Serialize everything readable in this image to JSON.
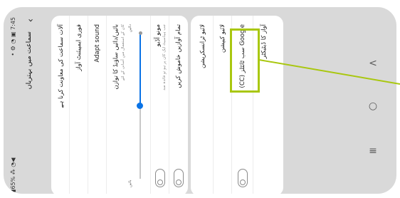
{
  "status_bar": {
    "time": "7:45",
    "left_icons": "• ⚙ ◔ ▣",
    "battery": "65%",
    "right_icons": "▮65% ⁂ ◔◀"
  },
  "header": {
    "title": "سماعت میں بہتریاں",
    "back_icon": "chevron-left-icon",
    "more_label": "—"
  },
  "card1": {
    "rows": [
      {
        "title": "آلات سماعت کی معاونت کرنا ہے"
      },
      {
        "title": "فوری ایمپیئنٹ آواز"
      },
      {
        "title": "Adapt sound"
      },
      {
        "title": "بائیں/دائیں ساؤنڈ کا توازن",
        "subtitle": "کان کے استعمال میں آسانی کے لئے"
      }
    ],
    "slider": {
      "left_label": "بائیں",
      "right_label": "دائیں",
      "value_fraction": 0.5
    },
    "toggle_rows": [
      {
        "title": "مونو آڈیو",
        "subtitle": "جب ہیڈسیٹ ایک کان پر ہو تو فائدہ مند"
      },
      {
        "title": "تمام آوازیں خاموش کریں"
      }
    ]
  },
  "card2": {
    "rows": [
      {
        "title": "لائیو ٹرانسکرپشن",
        "highlighted": true
      },
      {
        "title": "لائیو کیپشن"
      },
      {
        "title": "Google سب ٹائٹلز (CC)"
      },
      {
        "title": "آواز کا ڈیٹیکٹر"
      }
    ]
  },
  "nav": {
    "back": "<",
    "home": "○",
    "recents": "≡"
  },
  "colors": {
    "accent_blue": "#0a73e6",
    "highlight_green": "#a9c70f",
    "pointer_line": "#a9c70f"
  }
}
